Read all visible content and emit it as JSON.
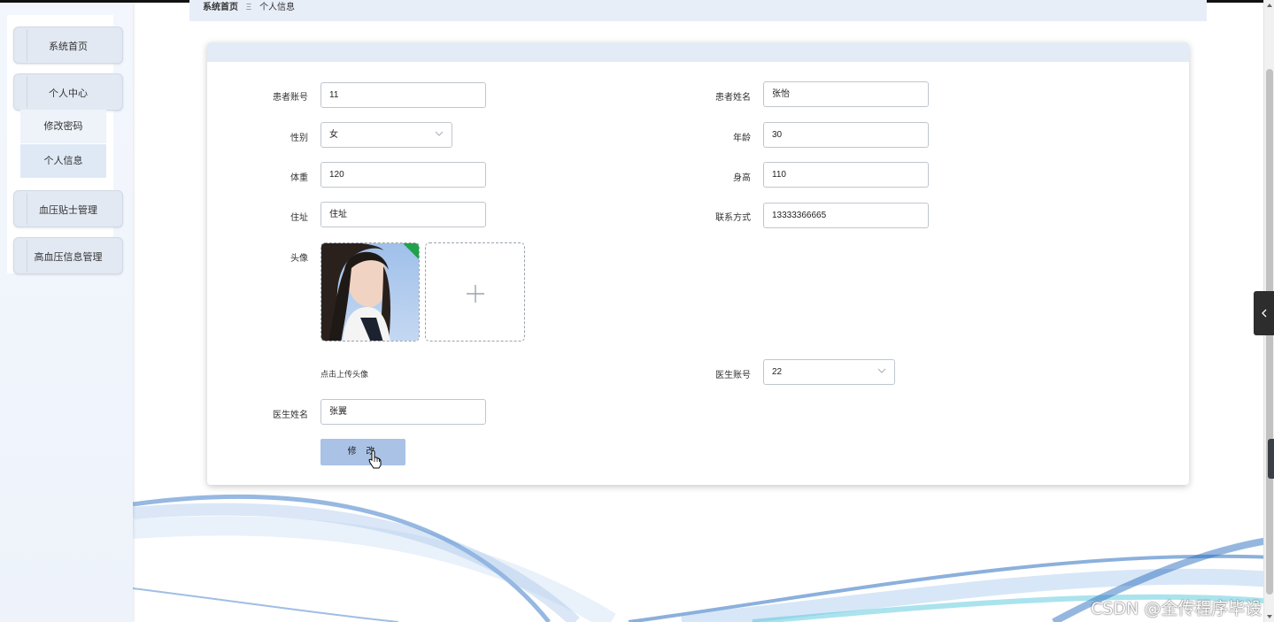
{
  "sidebar": {
    "menu": [
      {
        "label": "系统首页"
      },
      {
        "label": "个人中心"
      },
      {
        "label": "血压贴士管理"
      },
      {
        "label": "高血压信息管理"
      }
    ],
    "submenu": [
      {
        "label": "修改密码"
      },
      {
        "label": "个人信息"
      }
    ]
  },
  "breadcrumb": {
    "home": "系统首页",
    "separator": "Ξ",
    "current": "个人信息"
  },
  "form": {
    "patient_account_label": "患者账号",
    "patient_account_value": "11",
    "patient_name_label": "患者姓名",
    "patient_name_value": "张怡",
    "gender_label": "性别",
    "gender_value": "女",
    "age_label": "年龄",
    "age_value": "30",
    "weight_label": "体重",
    "weight_value": "120",
    "height_label": "身高",
    "height_value": "110",
    "address_label": "住址",
    "address_value": "住址",
    "contact_label": "联系方式",
    "contact_value": "13333366665",
    "avatar_label": "头像",
    "avatar_hint": "点击上传头像",
    "doctor_account_label": "医生账号",
    "doctor_account_value": "22",
    "doctor_name_label": "医生姓名",
    "doctor_name_value": "张翼",
    "submit_label": "修 改"
  },
  "watermark": "CSDN @全传程序毕设",
  "icons": {
    "select_arrow": "chevron-down-icon",
    "upload_add": "plus-icon",
    "side_toggle": "chevron-left-icon",
    "cursor": "hand-pointer-icon"
  },
  "colors": {
    "accent": "#a9c2e6",
    "header_band": "#e3ebf6",
    "breadcrumb_bg": "#e8eef8",
    "sidebar_item": "#e3e9f3"
  }
}
